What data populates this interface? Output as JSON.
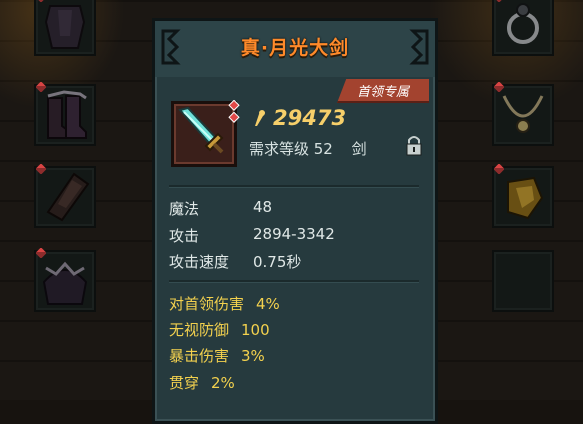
{
  "item": {
    "title": "真·月光大剑",
    "badge": "首领专属",
    "price": "29473",
    "requirement": "需求等级 52",
    "type": "剑"
  },
  "base_stats": [
    {
      "label": "魔法",
      "value": "48"
    },
    {
      "label": "攻击",
      "value": "2894-3342"
    },
    {
      "label": "攻击速度",
      "value": "0.75秒"
    }
  ],
  "bonus_stats": [
    {
      "label": "对首领伤害",
      "value": "4%"
    },
    {
      "label": "无视防御",
      "value": "100"
    },
    {
      "label": "暴击伤害",
      "value": "3%"
    },
    {
      "label": "贯穿",
      "value": "2%"
    }
  ],
  "colors": {
    "title": "#ff8a2a",
    "bonus_text": "#f3d14e",
    "badge": "#a3432f",
    "panel": "#263a3e"
  },
  "icons": [
    "coin-icon",
    "lock-icon",
    "sword-icon",
    "armor-icon",
    "boots-icon",
    "gauntlet-icon",
    "helmet-icon",
    "ring-icon",
    "necklace-icon",
    "pauldron-icon"
  ]
}
